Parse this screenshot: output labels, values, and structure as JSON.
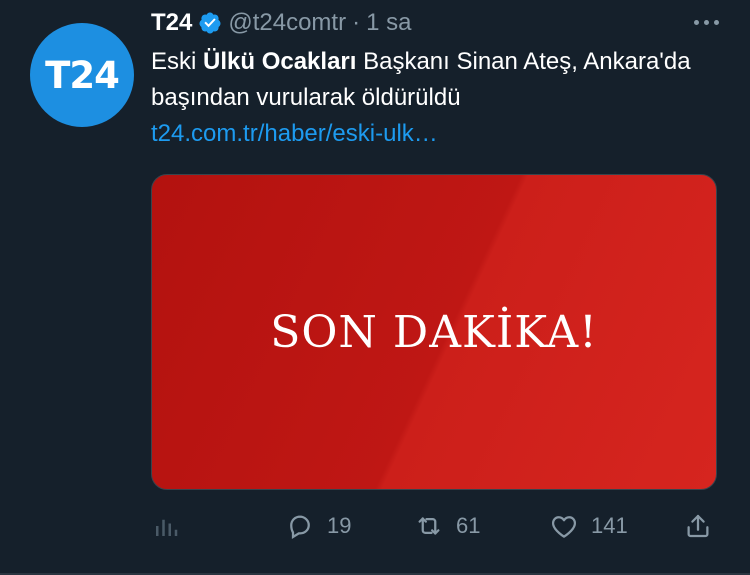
{
  "tweet": {
    "avatar_text": "T24",
    "name": "T24",
    "handle": "@t24comtr",
    "separator": "·",
    "time": "1 sa",
    "text_pre": "Eski ",
    "text_bold": "Ülkü Ocakları",
    "text_post": " Başkanı Sinan Ateş, Ankara'da başından vurularak öldürüldü",
    "link": "t24.com.tr/haber/eski-ulk…",
    "media_text": "SON DAKİKA!"
  },
  "actions": {
    "replies": "19",
    "retweets": "61",
    "likes": "141"
  },
  "colors": {
    "background": "#15202b",
    "accent": "#1d9bf0",
    "muted": "#8899a6",
    "avatar": "#1d8fe1",
    "media_red": "#c81b17"
  }
}
